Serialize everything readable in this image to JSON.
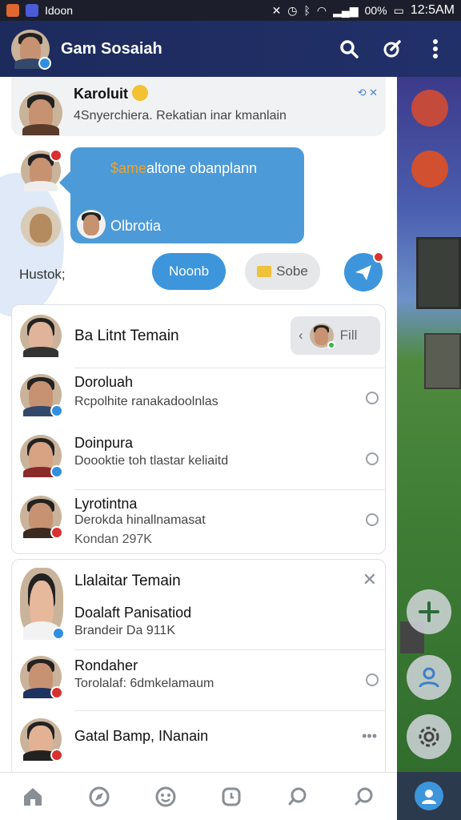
{
  "status_bar": {
    "app_label": "Idoon",
    "battery": "00%",
    "time": "12:5AM"
  },
  "header": {
    "title": "Gam Sosaiah"
  },
  "notification": {
    "title": "Karoluit",
    "subtitle": "4Snyerchiera. Rekatian inar kmanlain"
  },
  "chat": {
    "message_1_gold": "$ame",
    "message_1_rest": "altone obanplann",
    "message_2": "Olbrotia"
  },
  "quick_actions": {
    "label": "Hustok;",
    "primary": "Noonb",
    "secondary": "Sobe"
  },
  "friends_section": {
    "title": "Ba Litnt Temain",
    "fill_label": "Fill",
    "items": [
      {
        "name": "Doroluah",
        "status": "Rcpolhite ranakadoolnlas"
      },
      {
        "name": "Doinpura",
        "status": "Doooktie toh tlastar keliaitd"
      },
      {
        "name": "Lyrotintna",
        "status": "Derokda hinallnamasat",
        "meta": "Kondan 297K"
      }
    ]
  },
  "suggest_section": {
    "title": "Llalaitar Temain",
    "items": [
      {
        "name": "Doalaft Panisatiod",
        "status": "Brandeir Da 911K"
      },
      {
        "name": "Rondaher",
        "status": "Torolalaf: 6dmkelamaum"
      },
      {
        "name": "Gatal Bamp, INanain"
      }
    ]
  },
  "icons": {
    "header": [
      "search-icon",
      "edit-icon",
      "more-icon"
    ],
    "bottom_nav": [
      "home-icon",
      "compass-icon",
      "emoji-icon",
      "clock-icon",
      "chat-bubble-icon",
      "search-icon",
      "profile-icon"
    ]
  },
  "colors": {
    "header_bg": "#1d2a5c",
    "accent_blue": "#3d95dc",
    "badge_red": "#d93030"
  }
}
